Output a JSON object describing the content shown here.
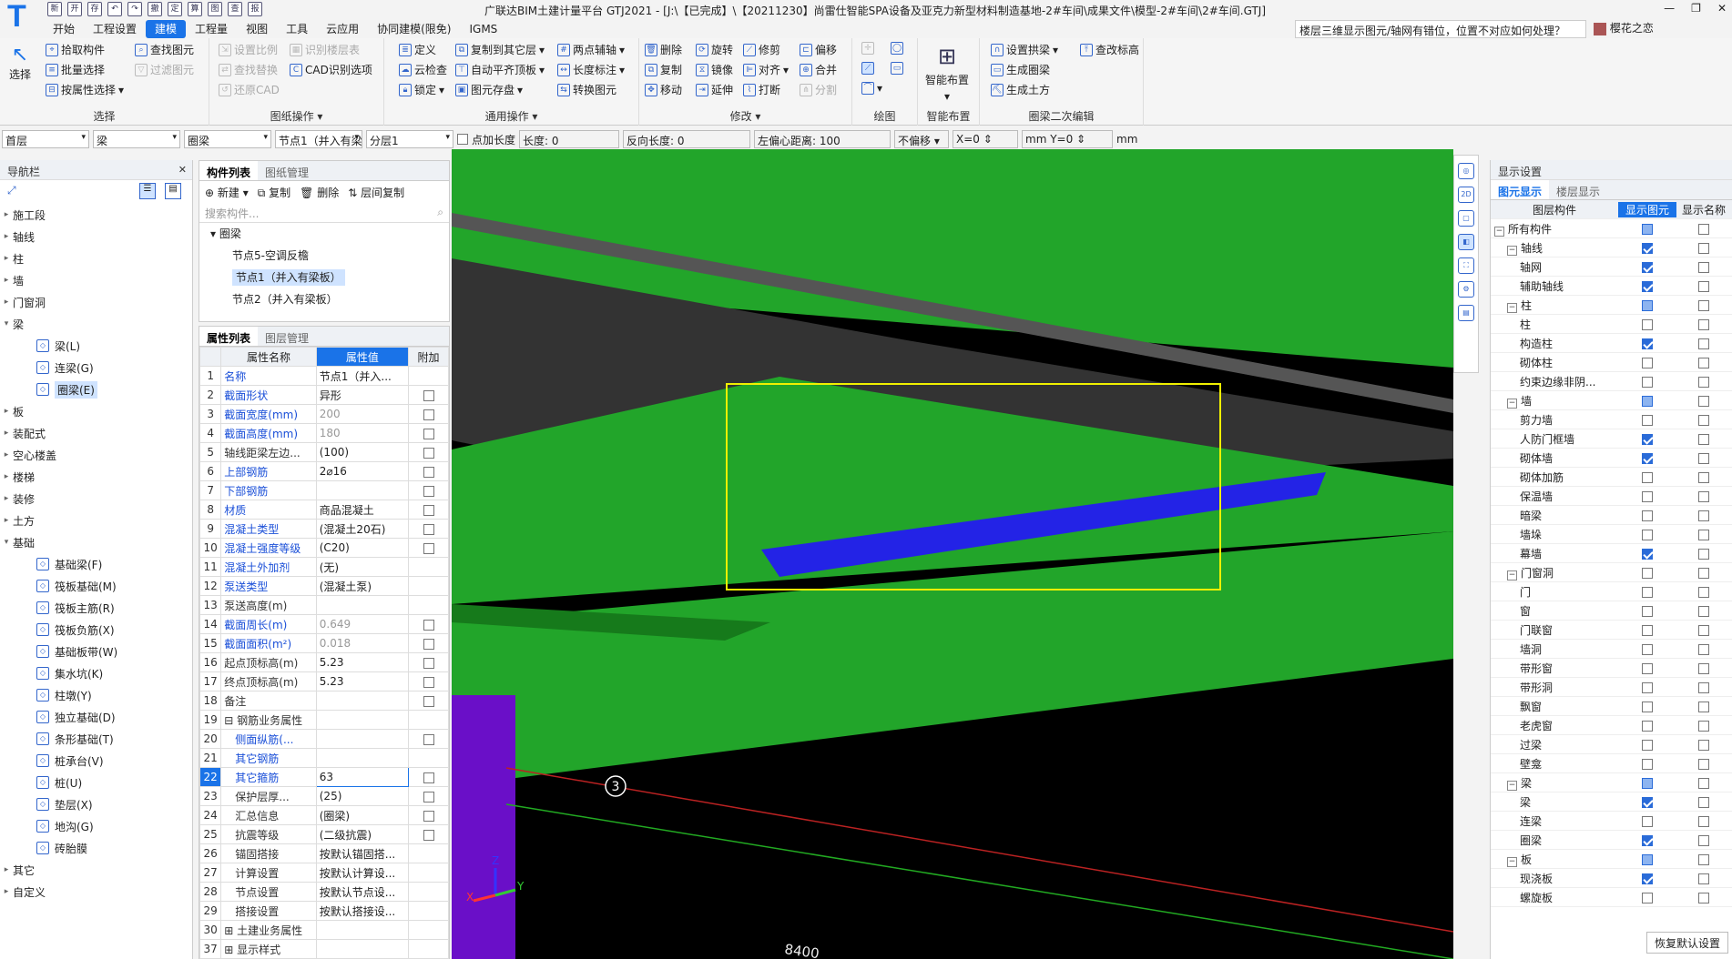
{
  "app": {
    "logo": "T",
    "title": "广联达BIM土建计量平台 GTJ2021 - [J:\\【已完成】\\【20211230】尚雷仕智能SPA设备及亚克力新型材料制造基地-2#车间\\成果文件\\模型-2#车间\\2#车间.GTJ]",
    "help_query": "楼层三维显示图元/轴网有错位，位置不对应如何处理？",
    "user": "樱花之恋",
    "window_controls": [
      "—",
      "❐",
      "✕"
    ]
  },
  "qat": [
    "新",
    "开",
    "存",
    "↶",
    "↷",
    "撤",
    "定",
    "算",
    "图",
    "查",
    "报"
  ],
  "menu": [
    "开始",
    "工程设置",
    "建模",
    "工程量",
    "视图",
    "工具",
    "云应用",
    "协同建模(限免)",
    "IGMS"
  ],
  "ribbon": {
    "select": {
      "label": "选择",
      "items": [
        "拾取构件",
        "批量选择",
        "按属性选择",
        "查找图元",
        "过滤图元"
      ]
    },
    "drawing_ops": {
      "label": "图纸操作",
      "items": [
        "设置比例",
        "识别楼层表",
        "查找替换",
        "CAD识别选项",
        "还原CAD"
      ]
    },
    "common_ops": {
      "label": "通用操作",
      "items": [
        "定义",
        "复制到其它层",
        "两点辅轴",
        "云检查",
        "自动平齐顶板",
        "长度标注",
        "锁定",
        "图元存盘",
        "转换图元"
      ]
    },
    "modify": {
      "label": "修改",
      "items": [
        "删除",
        "旋转",
        "修剪",
        "偏移",
        "复制",
        "镜像",
        "对齐",
        "合并",
        "移动",
        "延伸",
        "打断",
        "分割"
      ]
    },
    "draw": {
      "label": "绘图"
    },
    "smart": {
      "label": "智能布置",
      "items": [
        "智能布置"
      ]
    },
    "ring_beam": {
      "label": "圈梁二次编辑",
      "items": [
        "设置拱梁",
        "查改标高",
        "生成圈梁",
        "生成土方"
      ]
    }
  },
  "propbar": {
    "floor": "首层",
    "type": "梁",
    "subtype": "圈梁",
    "comp": "节点1（并入有梁板）",
    "layer": "分层1",
    "add_length_label": "点加长度",
    "length_label": "长度:",
    "length": "0",
    "rev_length_label": "反向长度:",
    "rev_length": "0",
    "offset_label": "左偏心距离:",
    "offset": "100",
    "no_offset": "不偏移",
    "x_label": "X=",
    "x": "0",
    "y_label": "mm Y=",
    "y": "0",
    "unit": "mm"
  },
  "nav": {
    "title": "导航栏",
    "items": [
      {
        "label": "施工段",
        "open": false
      },
      {
        "label": "轴线",
        "open": false
      },
      {
        "label": "柱",
        "open": false
      },
      {
        "label": "墙",
        "open": false
      },
      {
        "label": "门窗洞",
        "open": false
      },
      {
        "label": "梁",
        "open": true,
        "children": [
          {
            "label": "梁(L)"
          },
          {
            "label": "连梁(G)"
          },
          {
            "label": "圈梁(E)",
            "selected": true
          }
        ]
      },
      {
        "label": "板",
        "open": false
      },
      {
        "label": "装配式",
        "open": false
      },
      {
        "label": "空心楼盖",
        "open": false
      },
      {
        "label": "楼梯",
        "open": false
      },
      {
        "label": "装修",
        "open": false
      },
      {
        "label": "土方",
        "open": false
      },
      {
        "label": "基础",
        "open": true,
        "children": [
          {
            "label": "基础梁(F)"
          },
          {
            "label": "筏板基础(M)"
          },
          {
            "label": "筏板主筋(R)"
          },
          {
            "label": "筏板负筋(X)"
          },
          {
            "label": "基础板带(W)"
          },
          {
            "label": "集水坑(K)"
          },
          {
            "label": "柱墩(Y)"
          },
          {
            "label": "独立基础(D)"
          },
          {
            "label": "条形基础(T)"
          },
          {
            "label": "桩承台(V)"
          },
          {
            "label": "桩(U)"
          },
          {
            "label": "垫层(X)"
          },
          {
            "label": "地沟(G)"
          },
          {
            "label": "砖胎膜"
          }
        ]
      },
      {
        "label": "其它",
        "open": false
      },
      {
        "label": "自定义",
        "open": false
      }
    ]
  },
  "complist": {
    "tabs": [
      "构件列表",
      "图纸管理"
    ],
    "toolbar": [
      "新建",
      "复制",
      "删除",
      "层间复制"
    ],
    "search": "搜索构件...",
    "root": "圈梁",
    "items": [
      {
        "label": "节点5-空调反檐"
      },
      {
        "label": "节点1（并入有梁板）",
        "selected": true
      },
      {
        "label": "节点2（并入有梁板）"
      }
    ]
  },
  "proplist": {
    "tabs": [
      "属性列表",
      "图层管理"
    ],
    "headers": [
      "属性名称",
      "属性值",
      "附加"
    ],
    "rows": [
      {
        "n": "1",
        "k": "名称",
        "v": "节点1（并入...",
        "blue": true,
        "cb": null
      },
      {
        "n": "2",
        "k": "截面形状",
        "v": "异形",
        "blue": true,
        "cb": false
      },
      {
        "n": "3",
        "k": "截面宽度(mm)",
        "v": "200",
        "blue": true,
        "grey": true,
        "cb": false
      },
      {
        "n": "4",
        "k": "截面高度(mm)",
        "v": "180",
        "blue": true,
        "grey": true,
        "cb": false
      },
      {
        "n": "5",
        "k": "轴线距梁左边...",
        "v": "(100)",
        "cb": false
      },
      {
        "n": "6",
        "k": "上部钢筋",
        "v": "2⌀16",
        "blue": true,
        "cb": false
      },
      {
        "n": "7",
        "k": "下部钢筋",
        "v": "",
        "blue": true,
        "cb": false
      },
      {
        "n": "8",
        "k": "材质",
        "v": "商品混凝土",
        "blue": true,
        "cb": false
      },
      {
        "n": "9",
        "k": "混凝土类型",
        "v": "(混凝土20石)",
        "blue": true,
        "cb": false
      },
      {
        "n": "10",
        "k": "混凝土强度等级",
        "v": "(C20)",
        "blue": true,
        "cb": false
      },
      {
        "n": "11",
        "k": "混凝土外加剂",
        "v": "(无)",
        "blue": true,
        "cb": null
      },
      {
        "n": "12",
        "k": "泵送类型",
        "v": "(混凝土泵)",
        "blue": true,
        "cb": null
      },
      {
        "n": "13",
        "k": "泵送高度(m)",
        "v": "",
        "cb": null
      },
      {
        "n": "14",
        "k": "截面周长(m)",
        "v": "0.649",
        "blue": true,
        "grey": true,
        "cb": false
      },
      {
        "n": "15",
        "k": "截面面积(m²)",
        "v": "0.018",
        "blue": true,
        "grey": true,
        "cb": false
      },
      {
        "n": "16",
        "k": "起点顶标高(m)",
        "v": "5.23",
        "cb": false
      },
      {
        "n": "17",
        "k": "终点顶标高(m)",
        "v": "5.23",
        "cb": false
      },
      {
        "n": "18",
        "k": "备注",
        "v": "",
        "cb": false
      },
      {
        "n": "19",
        "k": "⊟ 钢筋业务属性",
        "v": "",
        "cb": null
      },
      {
        "n": "20",
        "k": "　侧面纵筋(...",
        "v": "",
        "blue": true,
        "cb": false
      },
      {
        "n": "21",
        "k": "　其它钢筋",
        "v": "",
        "blue": true,
        "cb": null
      },
      {
        "n": "22",
        "k": "　其它箍筋",
        "v": "63",
        "blue": true,
        "cb": false,
        "sel": true
      },
      {
        "n": "23",
        "k": "　保护层厚...",
        "v": "(25)",
        "cb": false
      },
      {
        "n": "24",
        "k": "　汇总信息",
        "v": "(圈梁)",
        "cb": false
      },
      {
        "n": "25",
        "k": "　抗震等级",
        "v": "(二级抗震)",
        "cb": false
      },
      {
        "n": "26",
        "k": "　锚固搭接",
        "v": "按默认锚固搭...",
        "cb": null
      },
      {
        "n": "27",
        "k": "　计算设置",
        "v": "按默认计算设...",
        "cb": null
      },
      {
        "n": "28",
        "k": "　节点设置",
        "v": "按默认节点设...",
        "cb": null
      },
      {
        "n": "29",
        "k": "　搭接设置",
        "v": "按默认搭接设...",
        "cb": null
      },
      {
        "n": "30",
        "k": "⊞ 土建业务属性",
        "v": "",
        "cb": null
      },
      {
        "n": "37",
        "k": "⊞ 显示样式",
        "v": "",
        "cb": null
      }
    ]
  },
  "viewport": {
    "axis_label": "3",
    "dimension": "8400",
    "axes": {
      "x": "X",
      "y": "Y",
      "z": "Z"
    }
  },
  "display": {
    "title": "显示设置",
    "tabs": [
      "图元显示",
      "楼层显示"
    ],
    "headers": [
      "图层构件",
      "显示图元",
      "显示名称"
    ],
    "rows": [
      {
        "name": "所有构件",
        "lvl": 0,
        "exp": "-",
        "c1": "part",
        "c2": false
      },
      {
        "name": "轴线",
        "lvl": 1,
        "exp": "-",
        "c1": true,
        "c2": false
      },
      {
        "name": "轴网",
        "lvl": 2,
        "c1": true,
        "c2": false
      },
      {
        "name": "辅助轴线",
        "lvl": 2,
        "c1": true,
        "c2": false
      },
      {
        "name": "柱",
        "lvl": 1,
        "exp": "-",
        "c1": "part",
        "c2": false
      },
      {
        "name": "柱",
        "lvl": 2,
        "c1": false,
        "c2": false
      },
      {
        "name": "构造柱",
        "lvl": 2,
        "c1": true,
        "c2": false
      },
      {
        "name": "砌体柱",
        "lvl": 2,
        "c1": false,
        "c2": false
      },
      {
        "name": "约束边缘非阴...",
        "lvl": 2,
        "c1": false,
        "c2": false
      },
      {
        "name": "墙",
        "lvl": 1,
        "exp": "-",
        "c1": "part",
        "c2": false
      },
      {
        "name": "剪力墙",
        "lvl": 2,
        "c1": false,
        "c2": false
      },
      {
        "name": "人防门框墙",
        "lvl": 2,
        "c1": true,
        "c2": false
      },
      {
        "name": "砌体墙",
        "lvl": 2,
        "c1": true,
        "c2": false
      },
      {
        "name": "砌体加筋",
        "lvl": 2,
        "c1": false,
        "c2": false
      },
      {
        "name": "保温墙",
        "lvl": 2,
        "c1": false,
        "c2": false
      },
      {
        "name": "暗梁",
        "lvl": 2,
        "c1": false,
        "c2": false
      },
      {
        "name": "墙垛",
        "lvl": 2,
        "c1": false,
        "c2": false
      },
      {
        "name": "幕墙",
        "lvl": 2,
        "c1": true,
        "c2": false
      },
      {
        "name": "门窗洞",
        "lvl": 1,
        "exp": "-",
        "c1": false,
        "c2": false
      },
      {
        "name": "门",
        "lvl": 2,
        "c1": false,
        "c2": false
      },
      {
        "name": "窗",
        "lvl": 2,
        "c1": false,
        "c2": false
      },
      {
        "name": "门联窗",
        "lvl": 2,
        "c1": false,
        "c2": false
      },
      {
        "name": "墙洞",
        "lvl": 2,
        "c1": false,
        "c2": false
      },
      {
        "name": "带形窗",
        "lvl": 2,
        "c1": false,
        "c2": false
      },
      {
        "name": "带形洞",
        "lvl": 2,
        "c1": false,
        "c2": false
      },
      {
        "name": "飘窗",
        "lvl": 2,
        "c1": false,
        "c2": false
      },
      {
        "name": "老虎窗",
        "lvl": 2,
        "c1": false,
        "c2": false
      },
      {
        "name": "过梁",
        "lvl": 2,
        "c1": false,
        "c2": false
      },
      {
        "name": "壁龛",
        "lvl": 2,
        "c1": false,
        "c2": false
      },
      {
        "name": "梁",
        "lvl": 1,
        "exp": "-",
        "c1": "part",
        "c2": false
      },
      {
        "name": "梁",
        "lvl": 2,
        "c1": true,
        "c2": false
      },
      {
        "name": "连梁",
        "lvl": 2,
        "c1": false,
        "c2": false
      },
      {
        "name": "圈梁",
        "lvl": 2,
        "c1": true,
        "c2": false
      },
      {
        "name": "板",
        "lvl": 1,
        "exp": "-",
        "c1": "part",
        "c2": false
      },
      {
        "name": "现浇板",
        "lvl": 2,
        "c1": true,
        "c2": false
      },
      {
        "name": "螺旋板",
        "lvl": 2,
        "c1": false,
        "c2": false
      }
    ],
    "restore": "恢复默认设置"
  },
  "colors": {
    "accent": "#1a73e8",
    "green": "#22a52a",
    "blue": "#2323e6",
    "purple": "#6a0fc8",
    "highlight": "#f0f000"
  }
}
